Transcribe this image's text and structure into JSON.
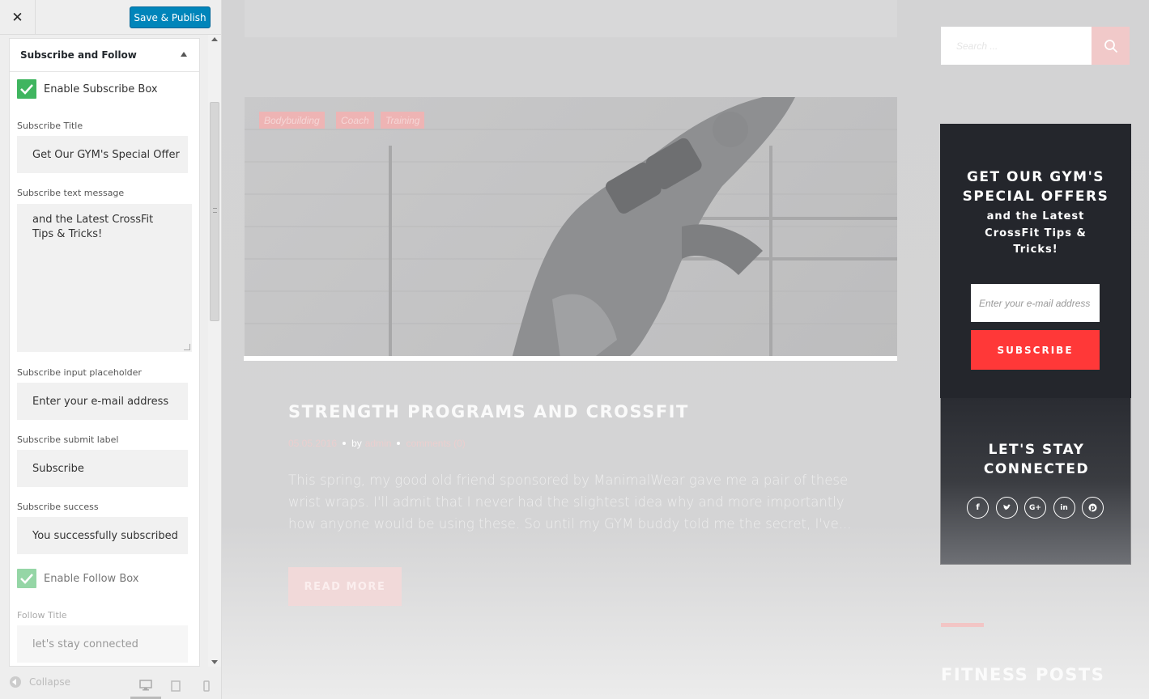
{
  "customizer": {
    "close_glyph": "✕",
    "save_label": "Save & Publish",
    "section_title": "Subscribe and Follow",
    "enable_subscribe_label": "Enable Subscribe Box",
    "subscribe_title_label": "Subscribe Title",
    "subscribe_title_value": "Get Our GYM's Special Offer",
    "subscribe_text_label": "Subscribe text message",
    "subscribe_text_value": "and the Latest CrossFit Tips & Tricks!",
    "input_placeholder_label": "Subscribe input placeholder",
    "input_placeholder_value": "Enter your e-mail address",
    "submit_label_label": "Subscribe submit label",
    "submit_label_value": "Subscribe",
    "success_label": "Subscribe success",
    "success_value": "You successfully subscribed",
    "enable_follow_label": "Enable Follow Box",
    "follow_title_label": "Follow Title",
    "follow_title_value": "let's stay connected",
    "collapse_label": "Collapse",
    "accent_color": "#0085ba",
    "check_color": "#3fb55f"
  },
  "preview": {
    "tags": [
      "Bodybuilding",
      "Coach",
      "Training"
    ],
    "post": {
      "title": "STRENGTH PROGRAMS AND CROSSFIT",
      "date": "05.05.2016",
      "by": "by",
      "author": "admin",
      "comments": "comments (0)",
      "excerpt": "This spring, my good old friend sponsored by ManimalWear gave me a pair of these wrist wraps. I'll admit that I never had the slightest idea why and more importantly how anyone would be using these. So until my GYM buddy told me the secret, I've...",
      "read_more": "READ MORE"
    },
    "search_placeholder": "Search ...",
    "subscribe": {
      "title_line1": "GET OUR GYM'S",
      "title_line2": "SPECIAL OFFERS",
      "text": "and the Latest CrossFit Tips & Tricks!",
      "input_placeholder": "Enter your e-mail address",
      "button": "SUBSCRIBE"
    },
    "follow": {
      "title_line1": "LET'S STAY",
      "title_line2": "CONNECTED",
      "icons": [
        "facebook-icon",
        "twitter-icon",
        "google-plus-icon",
        "linkedin-icon",
        "pinterest-icon"
      ]
    },
    "fitness_title": "FITNESS POSTS",
    "accent_color": "#ff3838"
  }
}
